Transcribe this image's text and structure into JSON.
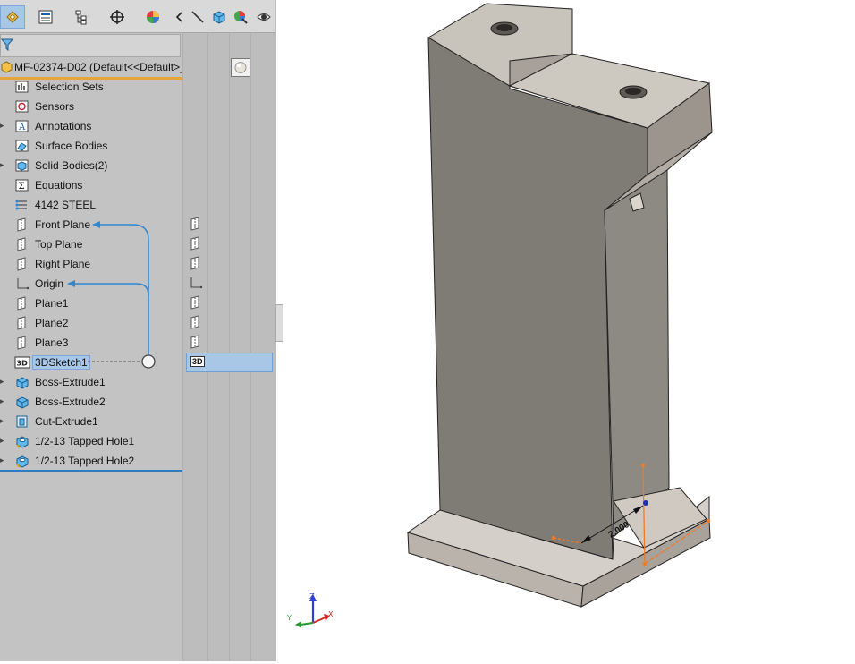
{
  "window": {
    "root_name": "MF-02374-D02  (Default<<Default>_"
  },
  "toolbar": {
    "icons": [
      "feature-manager-icon",
      "property-manager-icon",
      "configuration-manager-icon",
      "dimxpert-icon",
      "display-manager-icon",
      "arrow-left-icon",
      "sketch-line-icon",
      "view-cube-icon",
      "appearance-icon",
      "scene-icon"
    ]
  },
  "tree": {
    "items": [
      {
        "label": "Selection Sets",
        "icon": "selection-sets-icon"
      },
      {
        "label": "Sensors",
        "icon": "sensors-icon"
      },
      {
        "label": "Annotations",
        "icon": "annotations-icon"
      },
      {
        "label": "Surface Bodies",
        "icon": "surface-bodies-icon"
      },
      {
        "label": "Solid Bodies(2)",
        "icon": "solid-bodies-icon"
      },
      {
        "label": "Equations",
        "icon": "equations-icon"
      },
      {
        "label": "4142 STEEL",
        "icon": "material-icon"
      },
      {
        "label": "Front Plane",
        "icon": "plane-icon"
      },
      {
        "label": "Top Plane",
        "icon": "plane-icon"
      },
      {
        "label": "Right Plane",
        "icon": "plane-icon"
      },
      {
        "label": "Origin",
        "icon": "origin-icon"
      },
      {
        "label": "Plane1",
        "icon": "plane-icon"
      },
      {
        "label": "Plane2",
        "icon": "plane-icon"
      },
      {
        "label": "Plane3",
        "icon": "plane-icon"
      },
      {
        "label": "3DSketch1",
        "icon": "sketch-3d-icon"
      },
      {
        "label": "Boss-Extrude1",
        "icon": "extrude-icon"
      },
      {
        "label": "Boss-Extrude2",
        "icon": "extrude-icon"
      },
      {
        "label": "Cut-Extrude1",
        "icon": "cut-extrude-icon"
      },
      {
        "label": "1/2-13 Tapped Hole1",
        "icon": "hole-wizard-icon"
      },
      {
        "label": "1/2-13 Tapped Hole2",
        "icon": "hole-wizard-icon"
      }
    ]
  },
  "sketch_badge": "3D",
  "viewport": {
    "dimension_value": "2.000",
    "triad": {
      "x": "X",
      "y": "Y",
      "z": "Z"
    }
  },
  "colors": {
    "panel_bg": "#c3c3c3",
    "selection": "#a8c6e6",
    "root_underline": "#e4a63a",
    "tree_end_bar": "#2e7dc2",
    "part_face_light": "#c8c3bb",
    "part_face_mid": "#a39d95",
    "part_face_dark": "#7e7a74",
    "sketch_orange": "#f07a2a"
  }
}
